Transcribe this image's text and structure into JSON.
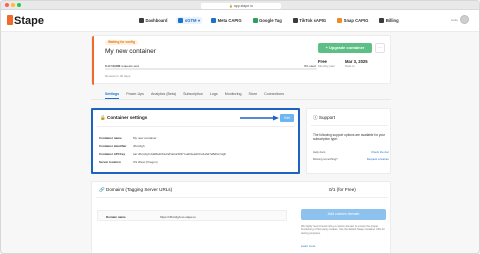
{
  "browser": {
    "url": "app.stape.io"
  },
  "header": {
    "logo": "Stape",
    "nav": [
      {
        "label": "Dashboard",
        "icon": "dashboard-icon",
        "active": false
      },
      {
        "label": "sGTM",
        "icon": "sgtm-icon",
        "active": true
      },
      {
        "label": "Meta CAPIG",
        "icon": "meta-icon",
        "active": false
      },
      {
        "label": "Google Tag",
        "icon": "google-tag-icon",
        "active": false
      },
      {
        "label": "TikTok sAPIG",
        "icon": "tiktok-icon",
        "active": false
      },
      {
        "label": "Snap CAPIG",
        "icon": "snap-icon",
        "active": false
      },
      {
        "label": "Billing",
        "icon": "billing-icon",
        "active": false
      }
    ],
    "user_line1": "Hello",
    "user_line2": ""
  },
  "container": {
    "status": "Waiting for config",
    "name": "My new container",
    "requests_used": "0 of 10,000",
    "requests_suffix": " requests sent",
    "percent_used": "0% used",
    "usage_fraction": 0,
    "renew_text": "Renews in 30 days",
    "upgrade_label": "+ Upgrade container",
    "more_label": "···",
    "plan": {
      "label": "Free",
      "sub": "Monthly plan"
    },
    "date": {
      "label": "Mar 3, 2025",
      "sub": "Date to"
    }
  },
  "tabs": [
    "Settings",
    "Power-Ups",
    "Analytics (Beta)",
    "Subscription",
    "Logs",
    "Monitoring",
    "Store",
    "Connections"
  ],
  "settings": {
    "title": "Container settings",
    "edit_label": "Edit",
    "rows": [
      {
        "key": "Container name",
        "value": "My new container"
      },
      {
        "key": "Container identifier",
        "value": "dfvrcdgh"
      },
      {
        "key": "Container API Key",
        "value": "sar:dfvrcdgh:2dd8a1b6a1/2NaCaSDFYuaK9eadCFxdahd7eBdfvrcdgh"
      },
      {
        "key": "Server location",
        "value": "US West (Oregon)"
      }
    ]
  },
  "support": {
    "title": "Support",
    "text": "The following support options are available for your subscription type:",
    "links": [
      {
        "label": "Help docs",
        "action": "Check the doc"
      },
      {
        "label": "Missing something?",
        "action": "Request a feature"
      }
    ]
  },
  "domains": {
    "title": "Domains (Tagging Server URLs)",
    "count": "0/1 (for Free)",
    "label": "Domain name",
    "value": "https://dfvrcdgh.us.stape.io",
    "add_label": "Add custom domain",
    "help": "We highly recommend using a custom domain to ensure the proper functioning of first-party cookies. Use the default Stape container URL for testing purposes.",
    "learn": "Learn more"
  }
}
